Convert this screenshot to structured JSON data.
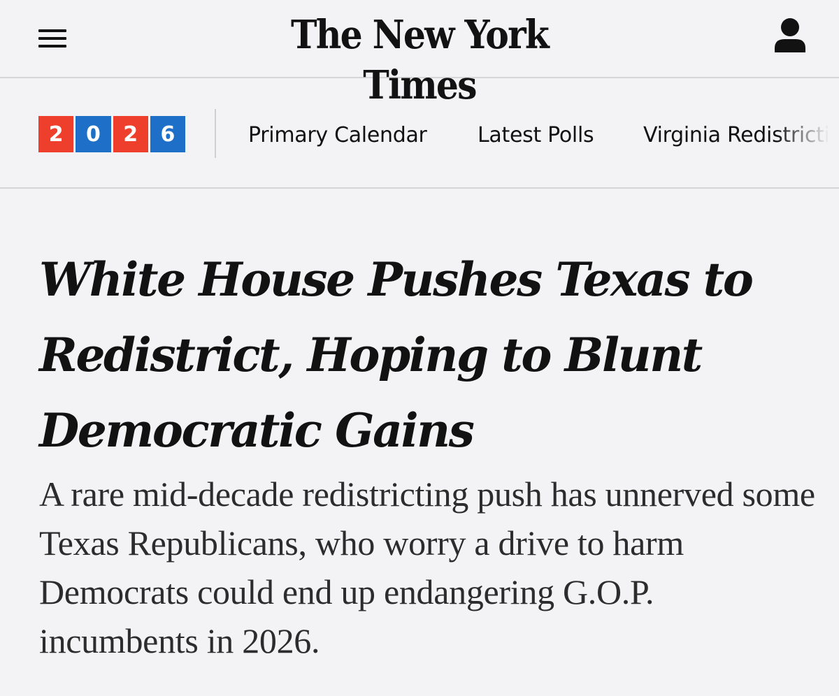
{
  "header": {
    "menu_icon": "hamburger-menu-icon",
    "masthead": "The New York Times",
    "account_icon": "user-account-icon"
  },
  "nav": {
    "logo": {
      "digits": [
        "2",
        "0",
        "2",
        "6"
      ],
      "colors": [
        "#ee3f2c",
        "#1d6fc8",
        "#ee3f2c",
        "#1d6fc8"
      ]
    },
    "links": [
      "Primary Calendar",
      "Latest Polls",
      "Virginia Redistricti"
    ]
  },
  "article": {
    "headline": "White House Pushes Texas to Redistrict, Hoping to Blunt Democratic Gains",
    "summary": "A rare mid-decade redistricting push has unnerved some Texas Republicans, who worry a drive to harm Democrats could end up endangering G.O.P. incumbents in 2026."
  }
}
